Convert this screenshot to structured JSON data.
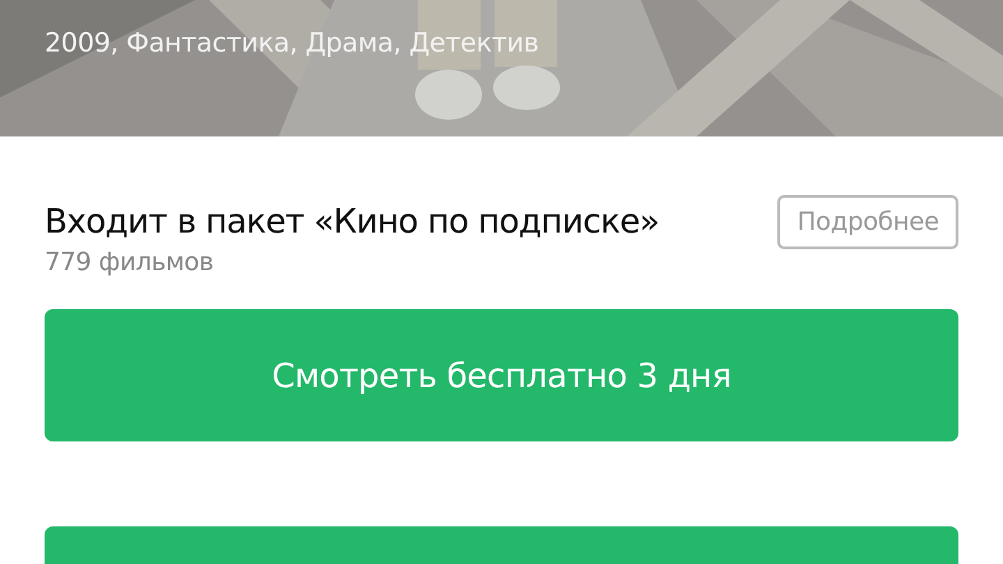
{
  "hero": {
    "kind": "picture",
    "subtitle": "2009, Фантастика, Драма, Детектив"
  },
  "package": {
    "title": "Входит в пакет «Кино по подписке»",
    "count": "779 фильмов",
    "more_button": "Подробнее"
  },
  "watch_button": "Смотреть бесплатно 3 дня"
}
